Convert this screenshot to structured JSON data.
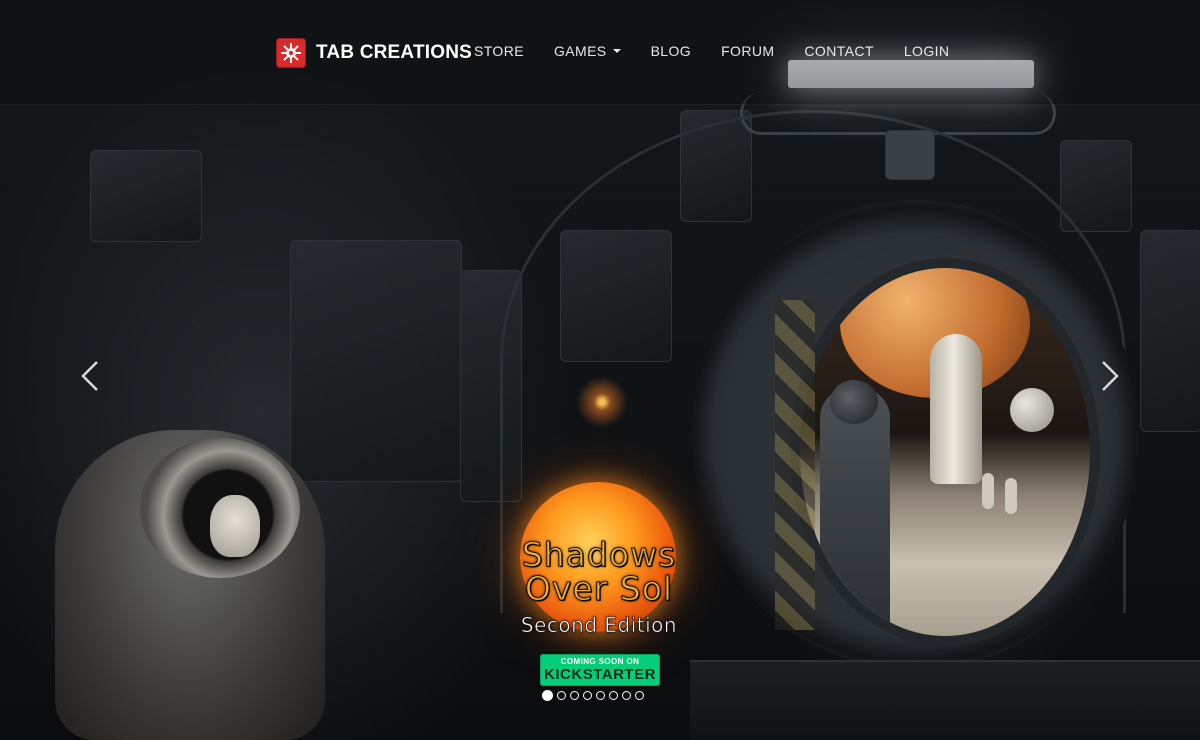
{
  "brand": {
    "name": "TAB CREATIONS",
    "logo_color": "#d82a2a"
  },
  "nav": {
    "items": [
      {
        "label": "STORE",
        "has_dropdown": false
      },
      {
        "label": "GAMES",
        "has_dropdown": true
      },
      {
        "label": "BLOG",
        "has_dropdown": false
      },
      {
        "label": "FORUM",
        "has_dropdown": false
      },
      {
        "label": "CONTACT",
        "has_dropdown": false
      },
      {
        "label": "LOGIN",
        "has_dropdown": false
      }
    ]
  },
  "carousel": {
    "prev_icon": "chevron-left-icon",
    "next_icon": "chevron-right-icon",
    "slide_count": 8,
    "active_index": 0,
    "slide": {
      "title_line1": "Shadows",
      "title_line2": "Over Sol",
      "subtitle": "Second Edition",
      "badge_top": "COMING SOON ON",
      "badge_main": "KICKSTARTER",
      "badge_color": "#05ce78",
      "title_color": "#f3ad3a"
    }
  }
}
